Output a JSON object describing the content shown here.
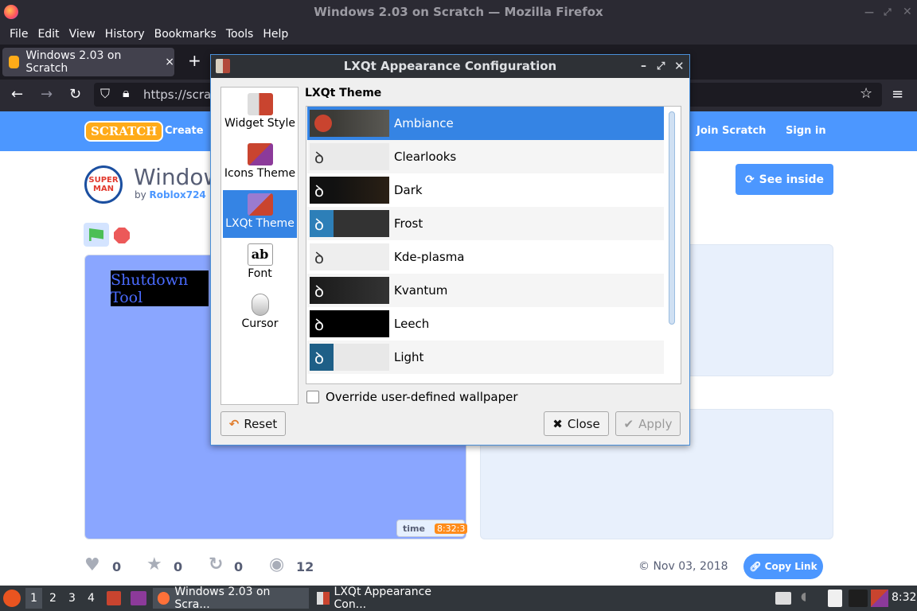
{
  "window": {
    "title": "Windows 2.03 on Scratch — Mozilla Firefox"
  },
  "menu": [
    "File",
    "Edit",
    "View",
    "History",
    "Bookmarks",
    "Tools",
    "Help"
  ],
  "tab": {
    "title": "Windows 2.03 on Scratch",
    "close": "×",
    "new": "+"
  },
  "nav": {
    "url": "https://scrat"
  },
  "scratch": {
    "logo": "SCRATCH",
    "create": "Create",
    "join": "Join Scratch",
    "signin": "Sign in",
    "project_title": "Window",
    "by": "by",
    "author": "Roblox724",
    "see_inside": "See inside",
    "stage_text": "Shutdown Tool",
    "time_label": "time",
    "time_value": "8:32:3",
    "loves": "0",
    "favorites": "0",
    "remixes": "0",
    "views": "12",
    "date": "© Nov 03, 2018",
    "copy_link": "Copy Link",
    "avatar_text": "SUPER MAN"
  },
  "dialog": {
    "title": "LXQt Appearance Configuration",
    "section": "LXQt Theme",
    "categories": [
      "Widget Style",
      "Icons Theme",
      "LXQt Theme",
      "Font",
      "Cursor"
    ],
    "selected_category": "LXQt Theme",
    "themes": [
      "Ambiance",
      "Clearlooks",
      "Dark",
      "Frost",
      "Kde-plasma",
      "Kvantum",
      "Leech",
      "Light"
    ],
    "selected_theme": "Ambiance",
    "override_label": "Override user-defined wallpaper",
    "override_checked": false,
    "reset": "Reset",
    "close": "Close",
    "apply": "Apply",
    "font_icon": "ab"
  },
  "taskbar": {
    "desktops": [
      "1",
      "2",
      "3",
      "4"
    ],
    "tasks": [
      "Windows 2.03 on Scra...",
      "LXQt Appearance Con..."
    ],
    "clock": "8:32"
  },
  "colors": {
    "accent": "#3584e4",
    "scratch_blue": "#4c97ff"
  }
}
